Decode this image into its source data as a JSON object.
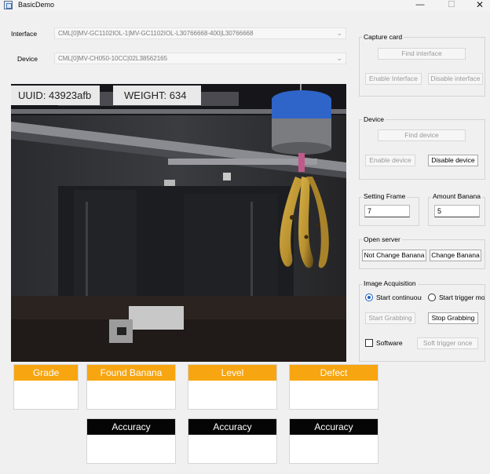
{
  "window": {
    "title": "BasicDemo",
    "minimize_glyph": "—",
    "maximize_glyph": "☐",
    "close_glyph": "✕"
  },
  "interface_row": {
    "label": "Interface",
    "value": "CML[0]MV-GC1102IOL-1|MV-GC1102IOL-L30766668-400|L30766668",
    "icon": "chevron-down-icon"
  },
  "device_row": {
    "label": "Device",
    "value": "CML[0]MV-CH050-10CC|02L38562165",
    "icon": "chevron-down-icon"
  },
  "camera": {
    "uuid_text": "UUID: 43923afb",
    "weight_text": "WEIGHT: 634"
  },
  "capture_card": {
    "title": "Capture card",
    "find_label": "Find interface",
    "enable_label": "Enable Interface",
    "disable_label": "Disable interface"
  },
  "device_group": {
    "title": "Device",
    "find_label": "Find device",
    "enable_label": "Enable device",
    "disable_label": "Disable device"
  },
  "setting_frame": {
    "title": "Setting Frame",
    "value": "7"
  },
  "amount_banana": {
    "title": "Amount Banana",
    "value": "5"
  },
  "open_server": {
    "title": "Open server",
    "not_change_label": "Not Change Banana",
    "change_label": "Change Banana"
  },
  "image_acquisition": {
    "title": "Image Acquisition",
    "continuous_label": "Start continuous",
    "trigger_label": "Start trigger mode",
    "start_grab_label": "Start Grabbing",
    "stop_grab_label": "Stop Grabbing",
    "software_label": "Software",
    "soft_trigger_label": "Soft trigger once",
    "continuous_selected": true,
    "software_checked": false
  },
  "result_cards": {
    "grade": "Grade",
    "found_banana": "Found Banana",
    "level": "Level",
    "defect": "Defect",
    "accuracy_1": "Accuracy",
    "accuracy_2": "Accuracy",
    "accuracy_3": "Accuracy"
  },
  "colors": {
    "card_orange": "#f7a511",
    "card_black": "#050505",
    "radio_blue": "#1f5fbf",
    "clamp_blue": "#2f64c8"
  }
}
